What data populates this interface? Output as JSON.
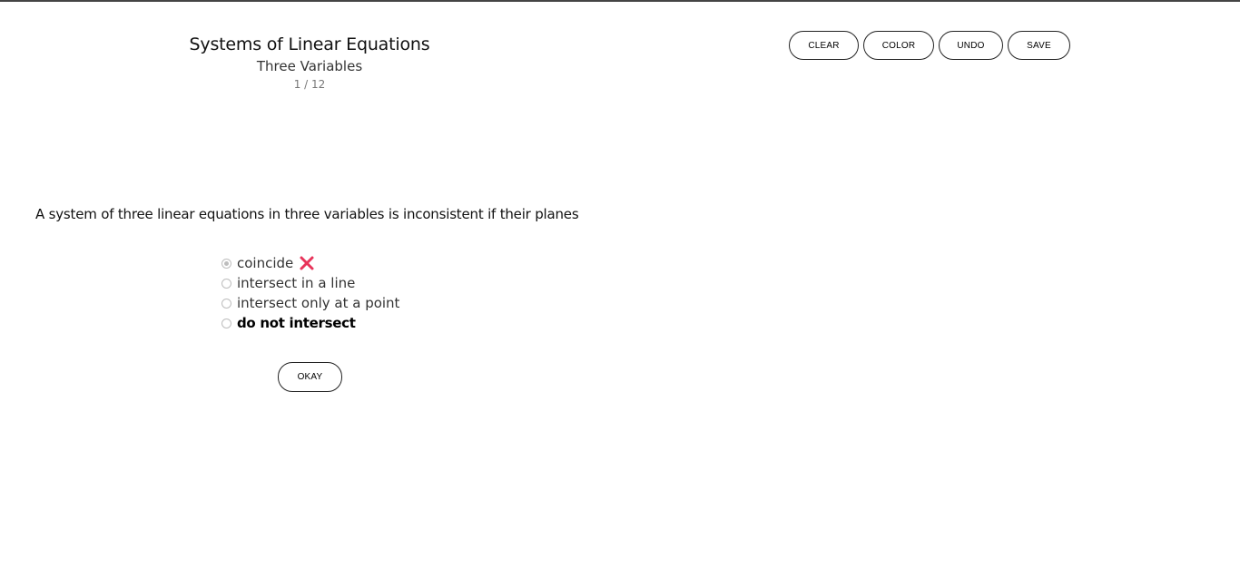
{
  "header": {
    "title": "Systems of Linear Equations",
    "subtitle": "Three Variables",
    "counter": "1 / 12"
  },
  "toolbar": {
    "clear_label": "CLEAR",
    "color_label": "COLOR",
    "undo_label": "UNDO",
    "save_label": "SAVE"
  },
  "question": {
    "text": "A system of three linear equations in three variables is inconsistent if their planes",
    "options": [
      {
        "label": "coincide",
        "selected": true,
        "marked_wrong": true
      },
      {
        "label": "intersect in a line",
        "selected": false
      },
      {
        "label": "intersect only at a point",
        "selected": false
      },
      {
        "label": "do not intersect",
        "selected": false,
        "emphasized": true
      }
    ],
    "submit_label": "OKAY"
  },
  "icons": {
    "wrong_mark": "cross-icon",
    "wrong_mark_color": "#e8345a"
  }
}
